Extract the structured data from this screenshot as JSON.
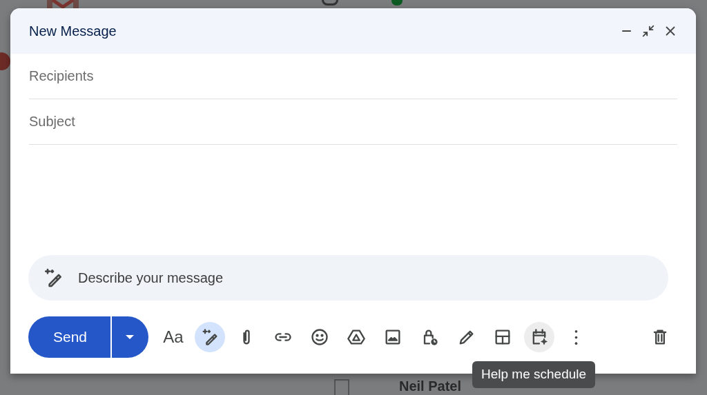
{
  "background": {
    "email_sender": "Neil Patel"
  },
  "compose": {
    "title": "New Message",
    "fields": [
      {
        "placeholder": "Recipients"
      },
      {
        "placeholder": "Subject"
      }
    ],
    "ai_prompt": {
      "placeholder": "Describe your message"
    },
    "send_label": "Send",
    "tools": [
      {
        "kind": "format",
        "label": "Aa",
        "selected": false,
        "hovered": false
      },
      {
        "kind": "write",
        "selected": true,
        "hovered": false
      },
      {
        "kind": "attach",
        "selected": false,
        "hovered": false
      },
      {
        "kind": "link",
        "selected": false,
        "hovered": false
      },
      {
        "kind": "emoji",
        "selected": false,
        "hovered": false
      },
      {
        "kind": "drive",
        "selected": false,
        "hovered": false
      },
      {
        "kind": "photo",
        "selected": false,
        "hovered": false
      },
      {
        "kind": "confidential",
        "selected": false,
        "hovered": false
      },
      {
        "kind": "signature",
        "selected": false,
        "hovered": false
      },
      {
        "kind": "layout",
        "selected": false,
        "hovered": false
      },
      {
        "kind": "schedule",
        "selected": false,
        "hovered": true
      },
      {
        "kind": "more",
        "selected": false,
        "hovered": false
      }
    ],
    "tooltip": "Help me schedule"
  }
}
